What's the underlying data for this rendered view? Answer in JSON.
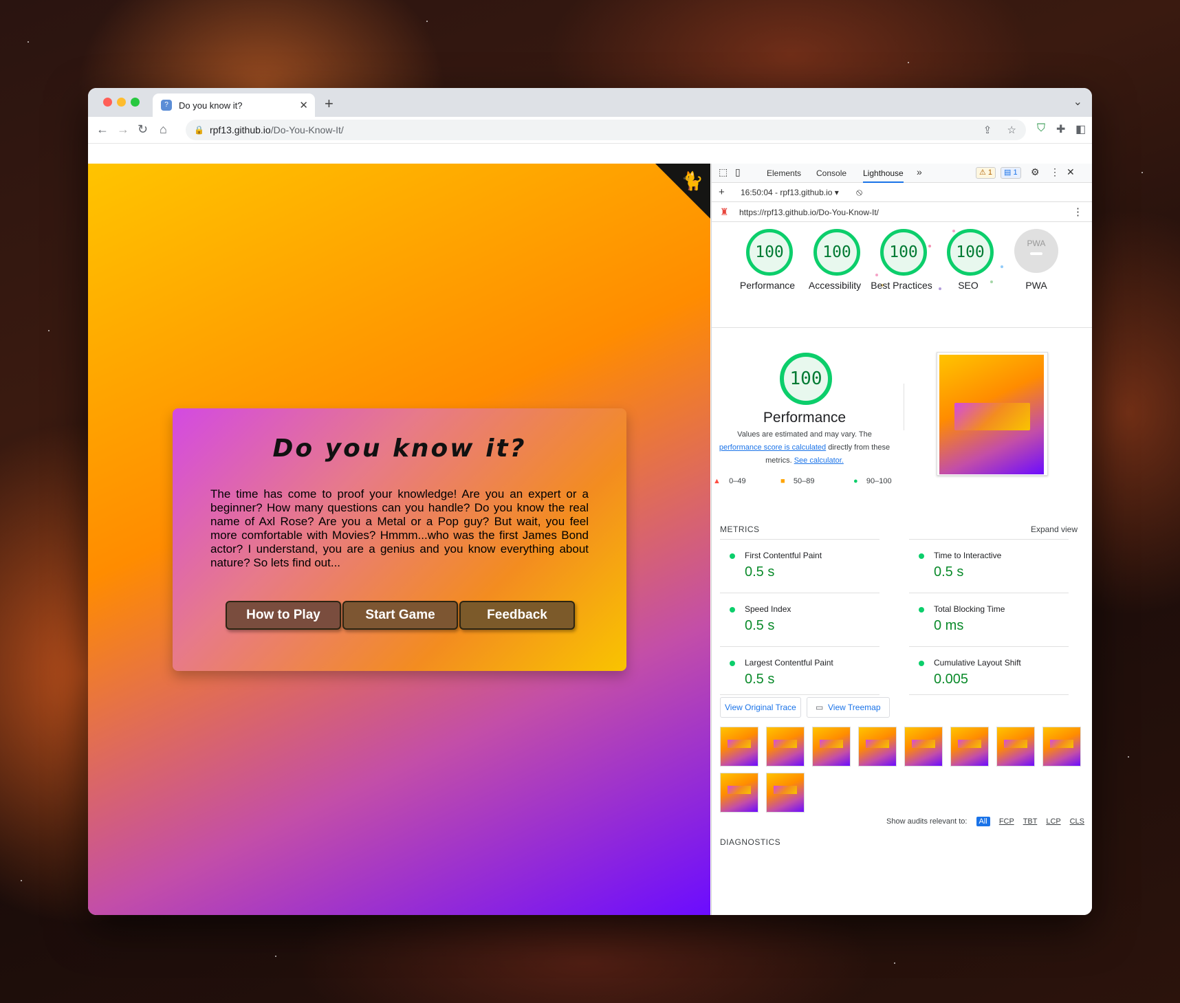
{
  "browser": {
    "tab_title": "Do you know it?",
    "url_host": "rpf13.github.io",
    "url_path": "/Do-You-Know-It/"
  },
  "page": {
    "heading": "Do you know it?",
    "intro": "The time has come to proof your knowledge! Are you an expert or a beginner? How many questions can you handle? Do you know the real name of Axl Rose? Are you a Metal or a Pop guy? But wait, you feel more comfortable with Movies? Hmmm...who was the first James Bond actor? I understand, you are a genius and you know everything about nature? So lets find out...",
    "buttons": [
      "How to Play",
      "Start Game",
      "Feedback"
    ],
    "colors": {
      "how_to_play": "#7a4d3e",
      "start_game": "#7d5632",
      "feedback": "#7c5a2a"
    }
  },
  "devtools": {
    "tabs": [
      "Elements",
      "Console",
      "Lighthouse"
    ],
    "active_tab": "Lighthouse",
    "warning_count": "1",
    "message_count": "1",
    "report_selector": "16:50:04 - rpf13.github.io",
    "report_url": "https://rpf13.github.io/Do-You-Know-It/",
    "categories": [
      {
        "score": "100",
        "label": "Performance"
      },
      {
        "score": "100",
        "label": "Accessibility"
      },
      {
        "score": "100",
        "label": "Best Practices"
      },
      {
        "score": "100",
        "label": "SEO"
      },
      {
        "score": "PWA",
        "label": "PWA"
      }
    ],
    "performance": {
      "score": "100",
      "title": "Performance",
      "desc_1": "Values are estimated and may vary. The",
      "desc_link": "performance score is calculated",
      "desc_2": "directly from these metrics.",
      "desc_link2": "See calculator.",
      "legend": [
        "0–49",
        "50–89",
        "90–100"
      ]
    },
    "metrics_header": "METRICS",
    "expand_view": "Expand view",
    "metrics": [
      {
        "name": "First Contentful Paint",
        "value": "0.5 s"
      },
      {
        "name": "Time to Interactive",
        "value": "0.5 s"
      },
      {
        "name": "Speed Index",
        "value": "0.5 s"
      },
      {
        "name": "Total Blocking Time",
        "value": "0 ms"
      },
      {
        "name": "Largest Contentful Paint",
        "value": "0.5 s"
      },
      {
        "name": "Cumulative Layout Shift",
        "value": "0.005"
      }
    ],
    "view_trace": "View Original Trace",
    "view_treemap": "View Treemap",
    "audits_label": "Show audits relevant to:",
    "audit_filters": [
      "All",
      "FCP",
      "TBT",
      "LCP",
      "CLS"
    ],
    "diagnostics": "DIAGNOSTICS",
    "colors": {
      "pass": "#0cce6b",
      "average": "#ffa400",
      "fail": "#ff4e42",
      "link": "#1a73e8"
    }
  }
}
